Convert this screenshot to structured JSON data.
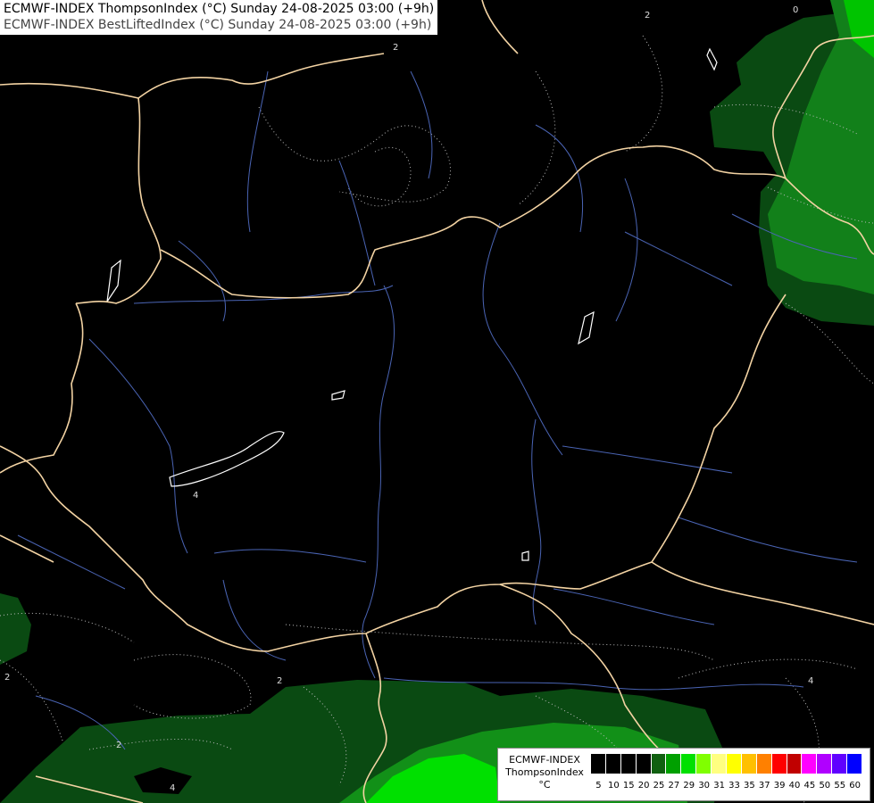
{
  "title": {
    "line1": "ECMWF-INDEX ThompsonIndex (°C) Sunday 24-08-2025 03:00 (+9h)",
    "line2": "ECMWF-INDEX BestLiftedIndex (°C) Sunday 24-08-2025 03:00 (+9h)"
  },
  "legend": {
    "line1": "ECMWF-INDEX",
    "line2": "ThompsonIndex",
    "line3": "°C",
    "colors": [
      "#000000",
      "#000000",
      "#000000",
      "#000000",
      "#0a3d0a",
      "#107010",
      "#00a000",
      "#00d800",
      "#80ff00",
      "#ffff80",
      "#ffff00",
      "#ffd000",
      "#ff9000",
      "#ff4000",
      "#e00000",
      "#a00000",
      "#ff00ff",
      "#c000ff",
      "#8000ff",
      "#4000ff",
      "#0000ff"
    ],
    "ticks": [
      "5",
      "10",
      "15",
      "20",
      "25",
      "27",
      "29",
      "30",
      "31",
      "33",
      "35",
      "37",
      "39",
      "40",
      "45",
      "50",
      "55",
      "60"
    ]
  },
  "contour_labels": [
    "2",
    "2",
    "0",
    "2",
    "4",
    "2",
    "2",
    "4",
    "4"
  ],
  "colors": {
    "background": "#000000",
    "border": "#f5d7a8",
    "river": "#4a66b8",
    "contour": "#b8b8b8",
    "fill_dark": "#0a4010",
    "fill_mid": "#138a13",
    "fill_bright": "#00c800"
  }
}
